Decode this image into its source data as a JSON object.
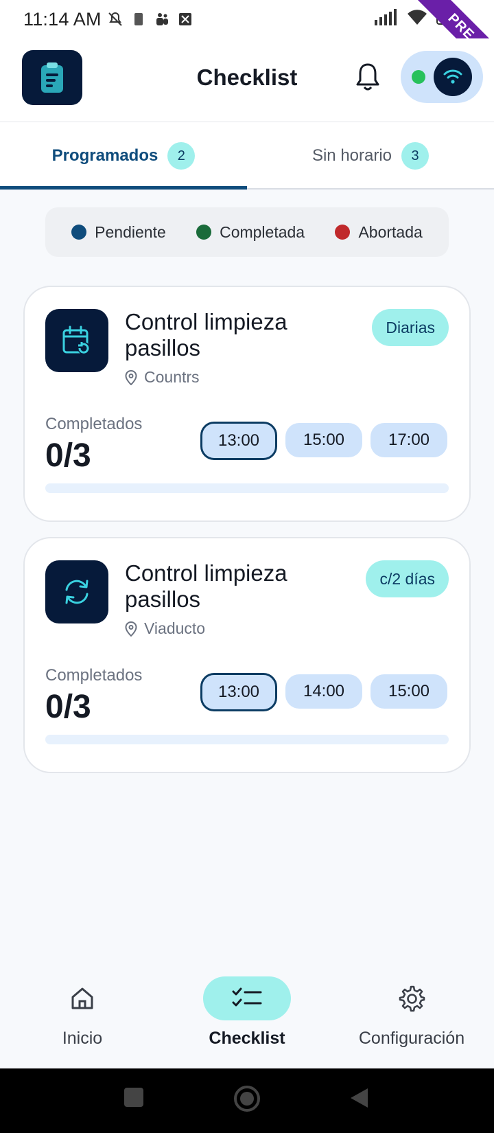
{
  "status_bar": {
    "time": "11:14 AM",
    "battery": "93",
    "build_ribbon": "PRE"
  },
  "app_bar": {
    "title": "Checklist",
    "logo_icon": "clipboard-icon",
    "notification_icon": "bell-icon",
    "connection": {
      "status_color": "#27c15b",
      "icon": "wifi-icon"
    }
  },
  "tabs": [
    {
      "label": "Programados",
      "count": "2",
      "active": true
    },
    {
      "label": "Sin horario",
      "count": "3",
      "active": false
    }
  ],
  "legend": [
    {
      "label": "Pendiente",
      "color": "#0f4c7c"
    },
    {
      "label": "Completada",
      "color": "#1a6b3a"
    },
    {
      "label": "Abortada",
      "color": "#c0292b"
    }
  ],
  "cards": [
    {
      "title": "Control limpieza pasillos",
      "location": "Countrs",
      "frequency": "Diarias",
      "icon": "calendar-refresh-icon",
      "completed_label": "Completados",
      "completed_value": "0/3",
      "progress": 0,
      "times": [
        "13:00",
        "15:00",
        "17:00"
      ],
      "selected_time": "13:00"
    },
    {
      "title": "Control limpieza pasillos",
      "location": "Viaducto",
      "frequency": "c/2 días",
      "icon": "sync-icon",
      "completed_label": "Completados",
      "completed_value": "0/3",
      "progress": 0,
      "times": [
        "13:00",
        "14:00",
        "15:00"
      ],
      "selected_time": "13:00"
    }
  ],
  "bottom_nav": [
    {
      "label": "Inicio",
      "icon": "home-icon",
      "active": false
    },
    {
      "label": "Checklist",
      "icon": "checklist-icon",
      "active": true
    },
    {
      "label": "Configuración",
      "icon": "gear-icon",
      "active": false
    }
  ],
  "colors": {
    "primary": "#0f4c7c",
    "dark": "#061a3a",
    "accent": "#9ff0ec",
    "chip": "#cfe3fb"
  }
}
